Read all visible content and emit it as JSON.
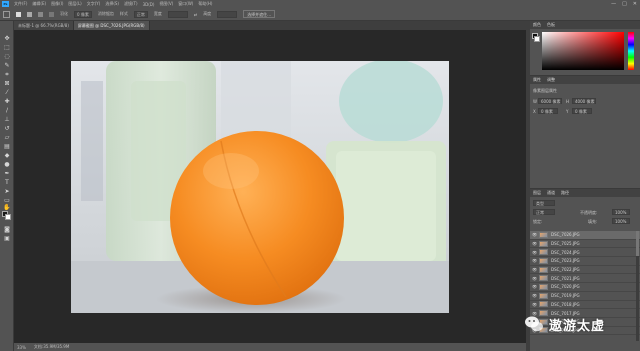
{
  "menubar": {
    "logo": "Ps",
    "items": [
      "文件(F)",
      "编辑(E)",
      "图像(I)",
      "图层(L)",
      "文字(Y)",
      "选择(S)",
      "滤镜(T)",
      "3D(D)",
      "视图(V)",
      "窗口(W)",
      "帮助(H)"
    ],
    "window_controls": [
      "—",
      "□",
      "✕"
    ]
  },
  "options_bar": {
    "feather_label": "羽化",
    "feather_value": "0 像素",
    "antialias_label": "消除锯齿",
    "style_label": "样式",
    "style_value": "正常",
    "width_label": "宽度",
    "height_label": "高度",
    "select_mask_button": "选择并遮住..."
  },
  "tabs": [
    {
      "label": "未标题-1 @ 66.7%(RGB/8)",
      "active": false
    },
    {
      "label": "屏幕截图 @ DSC_7026.JPG(RGB/8)",
      "active": true
    }
  ],
  "status": {
    "zoom": "33%",
    "doc_size": "文档:35.9M/35.9M"
  },
  "color_panel": {
    "tabs": [
      "颜色",
      "色板"
    ]
  },
  "properties_panel": {
    "tabs": [
      "属性",
      "调整"
    ],
    "title": "像素图层属性",
    "w_label": "W",
    "w_value": "6000 像素",
    "h_label": "H",
    "h_value": "4000 像素",
    "x_label": "X",
    "x_value": "0 像素",
    "y_label": "Y",
    "y_value": "0 像素"
  },
  "layers_panel": {
    "tabs": [
      "图层",
      "通道",
      "路径"
    ],
    "kind_label": "类型",
    "blend_mode": "正常",
    "opacity_label": "不透明度:",
    "opacity_value": "100%",
    "lock_label": "锁定:",
    "fill_label": "填充:",
    "fill_value": "100%",
    "layers": [
      {
        "name": "DSC_7026.JPG",
        "selected": true
      },
      {
        "name": "DSC_7025.JPG",
        "selected": false
      },
      {
        "name": "DSC_7024.JPG",
        "selected": false
      },
      {
        "name": "DSC_7023.JPG",
        "selected": false
      },
      {
        "name": "DSC_7022.JPG",
        "selected": false
      },
      {
        "name": "DSC_7021.JPG",
        "selected": false
      },
      {
        "name": "DSC_7020.JPG",
        "selected": false
      },
      {
        "name": "DSC_7019.JPG",
        "selected": false
      },
      {
        "name": "DSC_7018.JPG",
        "selected": false
      },
      {
        "name": "DSC_7017.JPG",
        "selected": false
      },
      {
        "name": "DSC_7016.JPG",
        "selected": false
      },
      {
        "name": "DSC_7015.JPG",
        "selected": false
      }
    ]
  },
  "watermark": {
    "text": "遨游太虚"
  },
  "colors": {
    "ui_panel": "#535353",
    "canvas_bg": "#282828",
    "accent": "#31a8ff",
    "orange": "#f4891f"
  }
}
